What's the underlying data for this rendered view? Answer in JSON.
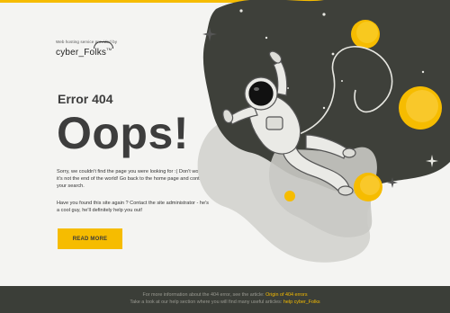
{
  "brand": {
    "caption": "Web hosting service provided by",
    "logo": "cyber_Folks",
    "trademark": "TM"
  },
  "error": {
    "code": "Error 404",
    "headline": "Oops!"
  },
  "message": {
    "paragraph1": "Sorry, we couldn't find the page you were looking for :( Don't worry, it's not the end of the world! Go back to the home page and continue your search.",
    "paragraph2": "Have you found this site again ? Contact the site administrator - he's a cool guy, he'll definitely help you out!"
  },
  "cta": {
    "read_more_label": "READ MORE"
  },
  "footer": {
    "line1_text": "For more information about the 404 error, see the article:",
    "line1_link": "Origin of 404 errors",
    "line2_text": "Take a look at our help section where you will find many useful articles:",
    "line2_link": "help cyber_Folks"
  },
  "colors": {
    "accent": "#f6bc00",
    "text_dark": "#3d3d3d",
    "background": "#f4f4f2",
    "footer_bg": "#3b3e38",
    "blob_dark": "#3e403a"
  },
  "illustration": {
    "subject": "astronaut floating in space",
    "icons": [
      "astronaut-icon",
      "planet-icon",
      "sparkle-icon"
    ]
  }
}
